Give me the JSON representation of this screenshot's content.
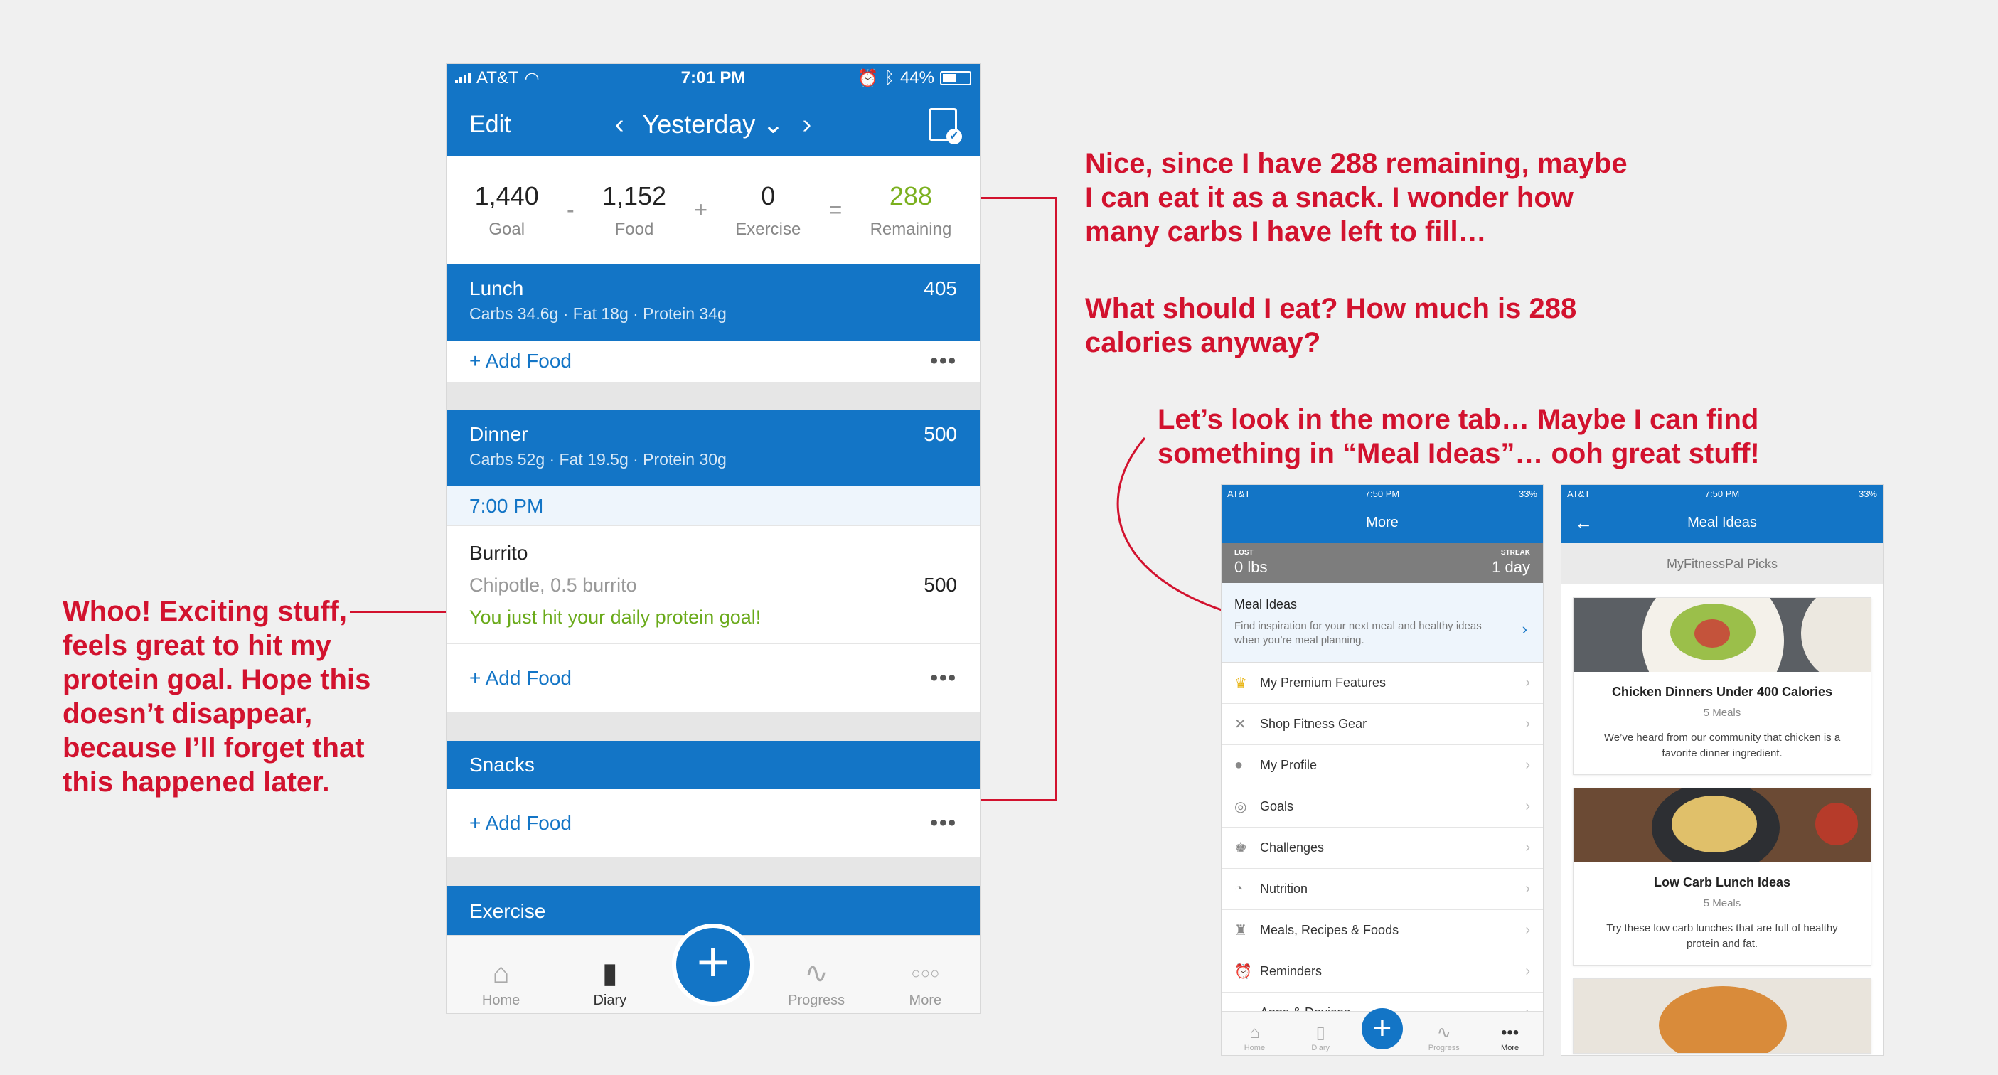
{
  "colors": {
    "brand_blue": "#1375c6",
    "remaining_green": "#7bb01e",
    "annotation_red": "#d2122e"
  },
  "annotations": {
    "top_right": [
      "Nice, since I have 288 remaining, maybe",
      "I can eat it as a snack. I wonder how",
      "many carbs I have left to fill…"
    ],
    "question": [
      "What should I eat? How much is 288",
      "calories anyway?"
    ],
    "more_tab": [
      "Let’s look in the more tab… Maybe I can find",
      "something in “Meal Ideas”… ooh great stuff!"
    ],
    "left": [
      "Whoo! Exciting stuff,",
      "feels great to hit my",
      "protein goal. Hope this",
      "doesn’t disappear,",
      "because I’ll forget that",
      "this happened later."
    ]
  },
  "main_phone": {
    "status": {
      "carrier": "AT&T",
      "time": "7:01 PM",
      "battery": "44%"
    },
    "nav": {
      "edit": "Edit",
      "date": "Yesterday",
      "prev": "‹",
      "next": "›",
      "dropdown": "⌄"
    },
    "summary": {
      "goal": "1,440",
      "goal_label": "Goal",
      "minus": "-",
      "food": "1,152",
      "food_label": "Food",
      "plus": "+",
      "exercise": "0",
      "exercise_label": "Exercise",
      "equals": "=",
      "remaining": "288",
      "remaining_label": "Remaining"
    },
    "lunch": {
      "name": "Lunch",
      "macros": "Carbs 34.6g · Fat 18g · Protein 34g",
      "calories": "405",
      "add_food": "+ Add Food",
      "more": "•••"
    },
    "dinner": {
      "name": "Dinner",
      "macros": "Carbs 52g · Fat 19.5g · Protein 30g",
      "calories": "500",
      "time": "7:00 PM",
      "item": {
        "name": "Burrito",
        "desc": "Chipotle, 0.5 burrito",
        "hit": "You just hit your daily protein goal!",
        "calories": "500"
      },
      "add_food": "+ Add Food",
      "more": "•••"
    },
    "snacks": {
      "name": "Snacks",
      "add_food": "+ Add Food",
      "more": "•••"
    },
    "exercise": {
      "name": "Exercise"
    },
    "tabs": {
      "home": "Home",
      "diary": "Diary",
      "progress": "Progress",
      "more": "More",
      "add": "+"
    }
  },
  "more_phone": {
    "status": {
      "carrier": "AT&T",
      "time": "7:50 PM",
      "battery": "33%"
    },
    "title": "More",
    "lost_key": "LOST",
    "lost_val": "0 lbs",
    "streak_key": "STREAK",
    "streak_val": "1 day",
    "meal_ideas": {
      "title": "Meal Ideas",
      "desc": "Find inspiration for your next meal and healthy ideas when you’re meal planning.",
      "chev": "›"
    },
    "items": [
      {
        "label": "My Premium Features",
        "icon": "crown-icon"
      },
      {
        "label": "Shop Fitness Gear",
        "icon": "ua-logo-icon"
      },
      {
        "label": "My Profile",
        "icon": "person-icon"
      },
      {
        "label": "Goals",
        "icon": "target-icon"
      },
      {
        "label": "Challenges",
        "icon": "trophy-icon"
      },
      {
        "label": "Nutrition",
        "icon": "pie-icon"
      },
      {
        "label": "Meals, Recipes & Foods",
        "icon": "chef-hat-icon"
      },
      {
        "label": "Reminders",
        "icon": "alarm-icon"
      },
      {
        "label": "Apps & Devices",
        "icon": "device-icon"
      }
    ],
    "tabs": {
      "home": "Home",
      "diary": "Diary",
      "progress": "Progress",
      "more": "More",
      "add": "+"
    }
  },
  "meal_phone": {
    "status": {
      "carrier": "AT&T",
      "time": "7:50 PM",
      "battery": "33%"
    },
    "title": "Meal Ideas",
    "back": "←",
    "picks": "MyFitnessPal Picks",
    "cards": [
      {
        "title": "Chicken Dinners Under 400 Calories",
        "meals": "5 Meals",
        "desc": "We’ve heard from our community that chicken is a favorite dinner ingredient."
      },
      {
        "title": "Low Carb Lunch Ideas",
        "meals": "5 Meals",
        "desc": "Try these low carb lunches that are full of healthy protein and fat."
      }
    ]
  }
}
